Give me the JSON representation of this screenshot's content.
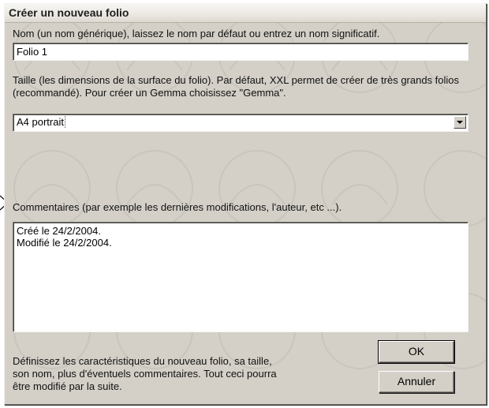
{
  "window": {
    "title": "Créer un nouveau folio"
  },
  "name": {
    "label": "Nom (un nom générique), laissez le nom par défaut ou entrez un nom significatif.",
    "value": "Folio 1"
  },
  "size": {
    "label": "Taille (les dimensions de la surface du folio). Par défaut, XXL permet de créer de très grands folios (recommandé). Pour créer un Gemma choisissez \"Gemma\".",
    "selected": "A4 portrait"
  },
  "comments": {
    "label": "Commentaires (par exemple les dernières modifications, l'auteur, etc ...).",
    "value": "Créé le 24/2/2004.\nModifié le 24/2/2004."
  },
  "footer": {
    "help": "Définissez les caractéristiques du nouveau folio, sa taille, son nom, plus d'éventuels commentaires. Tout ceci pourra être modifié par la suite."
  },
  "buttons": {
    "ok": "OK",
    "cancel": "Annuler"
  },
  "icons": {
    "dropdown": "chevron-down-icon",
    "pointer": "arrow-pointer-icon"
  }
}
